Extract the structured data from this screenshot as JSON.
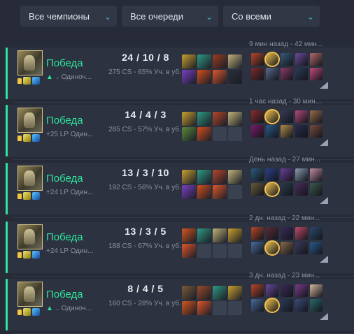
{
  "filters": {
    "champions": "Все чемпионы",
    "queues": "Все очереди",
    "with": "Со всеми"
  },
  "matches": [
    {
      "result": "Победа",
      "lp": "",
      "queue": "Одиноч...",
      "kda": "24 / 10 / 8",
      "stats": "275 CS - 65% Уч. в уб.",
      "time": "9 мин назад - 42 мин...",
      "items": [
        "#c9a030",
        "#2f9a83",
        "#9a3d1f",
        "#c2b27a",
        "#7b3fc4",
        "#d44d1a",
        "#e0562a",
        "#2b2f3a"
      ],
      "players": [
        "#b6462a",
        "#f2c14e",
        "#3a5a7b",
        "#6b4a9a",
        "#b06a6a",
        "#7a2b2b",
        "#5a6b8a",
        "#8a3b6b",
        "#2a3b5a",
        "#c24a7a"
      ]
    },
    {
      "result": "Победа",
      "lp": "+25 LP",
      "queue": "Один...",
      "kda": "14 / 4 / 3",
      "stats": "285 CS - 57% Уч. в уб.",
      "time": "1 час назад - 30 мин...",
      "items": [
        "#c9a030",
        "#2f9a83",
        "#b6462a",
        "#c2b27a",
        "#5a8a3a",
        "#d44d1a",
        "",
        ""
      ],
      "players": [
        "#8a2b2b",
        "#f2c14e",
        "#3a3a5a",
        "#b04a7a",
        "#9a6a4a",
        "#7a1b6b",
        "#2a5a8a",
        "#b08a4a",
        "#2a2b4a",
        "#7a4a3a"
      ]
    },
    {
      "result": "Победа",
      "lp": "+24 LP",
      "queue": "Один...",
      "kda": "13 / 3 / 10",
      "stats": "192 CS - 56% Уч. в уб.",
      "time": "День назад - 27 мин...",
      "items": [
        "#c9a030",
        "#2f9a83",
        "#b6462a",
        "#c2b27a",
        "#7b3fc4",
        "#d44d1a",
        "#e0562a",
        ""
      ],
      "players": [
        "#2a5a7a",
        "#2b3f8a",
        "#6a3f9a",
        "#8a9ab0",
        "#c08aa0",
        "#6a5a3a",
        "#f2c14e",
        "#2a3b4a",
        "#4a2b5a",
        "#3a5a4a"
      ]
    },
    {
      "result": "Победа",
      "lp": "+24 LP",
      "queue": "Один...",
      "kda": "13 / 3 / 5",
      "stats": "188 CS - 67% Уч. в уб.",
      "time": "2 дн. назад - 22 мин...",
      "items": [
        "#d4561f",
        "#2f9a83",
        "#c2b27a",
        "#c9a030",
        "#e0562a",
        "",
        "",
        ""
      ],
      "players": [
        "#b6462a",
        "#5a2b3a",
        "#3a2b5a",
        "#c04a6a",
        "#2a4a6a",
        "#4a6a9a",
        "#f2c14e",
        "#8a6a4a",
        "#3a3a5a",
        "#2a5a8a"
      ]
    },
    {
      "result": "Победа",
      "lp": "",
      "queue": "Одиноч...",
      "kda": "8 / 4 / 5",
      "stats": "160 CS - 28% Уч. в уб.",
      "time": "3 дн. назад - 23 мин...",
      "items": [
        "#7a5a3a",
        "#9a4a2a",
        "#2f9a83",
        "#c9a030",
        "#d4561f",
        "#e0562a",
        "",
        ""
      ],
      "players": [
        "#b6462a",
        "#6a4a9a",
        "#3a2b5a",
        "#7a3a8a",
        "#d8b8a0",
        "#4a6a9a",
        "#f2c14e",
        "#2a3b5a",
        "#3a4a7a",
        "#2a6a6a"
      ]
    }
  ]
}
